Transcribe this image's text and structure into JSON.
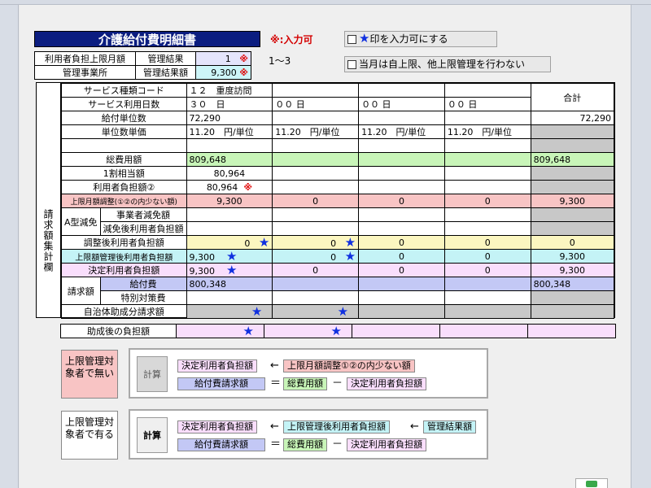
{
  "header": {
    "title": "介護給付費明細書",
    "input_legend": "※:入力可",
    "star_toggle_label": "印を入力可にする",
    "self_limit_label": "当月は自上限、他上限管理を行わない"
  },
  "limit_info": {
    "row1_label": "利用者負担上限月額",
    "row2_label": "管理事業所",
    "mgmt_result_label": "管理結果",
    "mgmt_result_value": "1",
    "mgmt_amount_label": "管理結果額",
    "mgmt_amount_value": "9,300",
    "mark": "※",
    "range_note": "1〜3"
  },
  "main": {
    "section_label": "請求額集計欄",
    "service_code_label": "サービス種類コード",
    "service_code_value": "１２　重度訪問",
    "days_label": "サービス利用日数",
    "days": [
      "３０　日",
      "００ 日",
      "００ 日",
      "００ 日"
    ],
    "total_header": "合計",
    "units_label": "給付単位数",
    "units_value": "72,290",
    "units_total": "72,290",
    "unit_price_label": "単位数単価",
    "unit_prices": [
      "11.20　円/単位",
      "11.20　円/単位",
      "11.20　円/単位",
      "11.20　円/単位"
    ],
    "total_cost_label": "総費用額",
    "total_cost_value": "809,648",
    "total_cost_total": "809,648",
    "ten_percent_label": "1割相当額",
    "ten_percent_value": "80,964",
    "burden2_label": "利用者負担額②",
    "burden2_value": "80,964",
    "burden2_mark": "※",
    "limit_adjust_label": "上限月額調整(①②の内少ない額)",
    "limit_adjust": [
      "9,300",
      "0",
      "0",
      "0",
      "9,300"
    ],
    "a_type_label": "A型減免",
    "provider_reduction_label": "事業者減免額",
    "after_reduction_label": "減免後利用者負担額",
    "adjusted_burden_label": "調整後利用者負担額",
    "adjusted_burden": [
      "0",
      "0",
      "0",
      "0",
      "0"
    ],
    "limit_managed_label": "上限額管理後利用者負担額",
    "limit_managed": [
      "9,300",
      "0",
      "0",
      "0",
      "9,300"
    ],
    "decided_burden_label": "決定利用者負担額",
    "decided_burden": [
      "9,300",
      "0",
      "0",
      "0",
      "9,300"
    ],
    "claim_label": "請求額",
    "benefit_label": "給付費",
    "benefit_value": "800,348",
    "benefit_total": "800,348",
    "special_label": "特別対策費",
    "municipal_label": "自治体助成分請求額",
    "star": "★"
  },
  "after_subsidy": {
    "label": "助成後の負担額"
  },
  "calc1": {
    "note": "上限管理対象者で無い",
    "button": "計算",
    "decided": "決定利用者負担額",
    "arrow": "←",
    "limit_adjust": "上限月額調整①②の内少ない額",
    "benefit_claim": "給付費請求額",
    "equals": "＝",
    "total_cost": "総費用額",
    "minus": "－",
    "decided2": "決定利用者負担額"
  },
  "calc2": {
    "note": "上限管理対象者で有る",
    "button": "計算",
    "decided": "決定利用者負担額",
    "arrow": "←",
    "limit_managed": "上限管理後利用者負担額",
    "arrow2": "←",
    "mgmt_amount": "管理結果額",
    "benefit_claim": "給付費請求額",
    "equals": "＝",
    "total_cost": "総費用額",
    "minus": "－",
    "decided2": "決定利用者負担額"
  }
}
